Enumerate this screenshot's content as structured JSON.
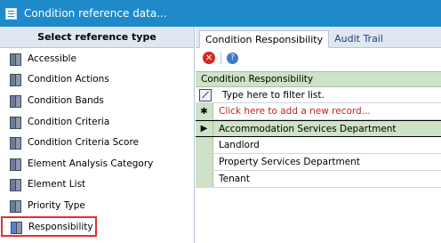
{
  "window": {
    "title": "Condition reference data..."
  },
  "left_panel": {
    "header": "Select reference type",
    "items": [
      {
        "label": "Accessible"
      },
      {
        "label": "Condition Actions"
      },
      {
        "label": "Condition Bands"
      },
      {
        "label": "Condition Criteria"
      },
      {
        "label": "Condition Criteria Score"
      },
      {
        "label": "Element Analysis Category"
      },
      {
        "label": "Element List"
      },
      {
        "label": "Priority Type"
      },
      {
        "label": "Responsibility"
      }
    ]
  },
  "tabs": [
    {
      "label": "Condition Responsibility"
    },
    {
      "label": "Audit Trail"
    }
  ],
  "grid": {
    "column_header": "Condition Responsibility",
    "filter_placeholder": "Type here to filter list.",
    "add_new": "Click here to add a new record...",
    "rows": [
      {
        "value": "Accommodation Services Department"
      },
      {
        "value": "Landlord"
      },
      {
        "value": "Property Services Department"
      },
      {
        "value": "Tenant"
      }
    ]
  },
  "colors": {
    "titlebar": "#1e8ac9",
    "grid_header": "#cde2c6",
    "highlight_border": "#e4302b"
  }
}
